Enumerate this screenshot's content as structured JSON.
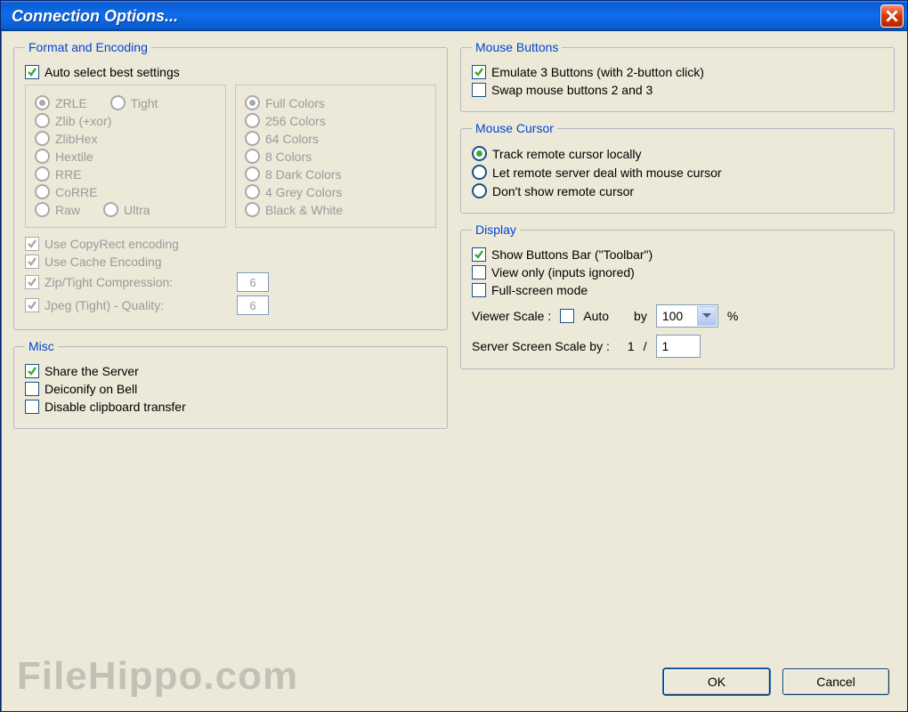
{
  "title": "Connection Options...",
  "format": {
    "legend": "Format and Encoding",
    "auto": "Auto select best settings",
    "encodings": {
      "zrle": "ZRLE",
      "tight": "Tight",
      "zlibxor": "Zlib (+xor)",
      "zlibhex": "ZlibHex",
      "hextile": "Hextile",
      "rre": "RRE",
      "corre": "CoRRE",
      "raw": "Raw",
      "ultra": "Ultra"
    },
    "colors": {
      "full": "Full Colors",
      "c256": "256 Colors",
      "c64": "64 Colors",
      "c8": "8 Colors",
      "d8": "8 Dark Colors",
      "g4": "4 Grey Colors",
      "bw": "Black & White"
    },
    "copyrect": "Use CopyRect encoding",
    "cache": "Use Cache Encoding",
    "zipcomp": "Zip/Tight Compression:",
    "zipval": "6",
    "jpegq": "Jpeg (Tight) - Quality:",
    "jpegval": "6"
  },
  "misc": {
    "legend": "Misc",
    "share": "Share the Server",
    "deicon": "Deiconify on Bell",
    "noclip": "Disable clipboard transfer"
  },
  "mousebtn": {
    "legend": "Mouse Buttons",
    "emu3": "Emulate 3 Buttons (with 2-button click)",
    "swap": "Swap mouse buttons 2 and 3"
  },
  "cursor": {
    "legend": "Mouse Cursor",
    "track": "Track remote cursor locally",
    "remote": "Let remote server deal with mouse cursor",
    "hide": "Don't show remote cursor"
  },
  "display": {
    "legend": "Display",
    "toolbar": "Show Buttons Bar (\"Toolbar\")",
    "viewonly": "View only (inputs ignored)",
    "fullscreen": "Full-screen mode",
    "vscale_lbl": "Viewer Scale :",
    "vscale_auto": "Auto",
    "vscale_by": "by",
    "vscale_val": "100",
    "vscale_pct": "%",
    "sscale_lbl": "Server Screen Scale by :",
    "sscale_num": "1",
    "sscale_sep": "/",
    "sscale_den": "1"
  },
  "buttons": {
    "ok": "OK",
    "cancel": "Cancel"
  },
  "watermark": "FileHippo.com"
}
